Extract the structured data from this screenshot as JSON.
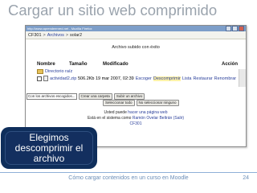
{
  "slide": {
    "title": "Cargar un sitio web comprimido",
    "footer": "Cómo cargar contenidos en un curso en Moodle",
    "page_number": "24"
  },
  "browser": {
    "window_title": "http://www.aprendeenred.net - Mozilla Firefox",
    "breadcrumb": {
      "root": "CF301",
      "sep1": ">",
      "files": "Archivos",
      "sep2": ">",
      "folder": "solar2"
    },
    "message": "Archivo subido con éxito",
    "table": {
      "headers": {
        "name": "Nombre",
        "size": "Tamaño",
        "modified": "Modificado",
        "action": "Acción"
      },
      "parent_dir": "Directorio raíz",
      "file": {
        "name": "actividad2.zip",
        "size": "506.2Kb",
        "modified": "19 mar 2007, 02:39",
        "action_choose": "Escoger",
        "action_unzip": "Descomprimir",
        "action_list": "Lista",
        "action_restore": "Restaurar",
        "action_rename": "Renombrar"
      }
    },
    "bottom": {
      "select_value": "Con los archivos escogidos...",
      "create_folder": "Crear una carpeta",
      "upload": "Subir un archivo",
      "select_all": "Seleccionar todo",
      "select_none": "No seleccionar ninguno"
    },
    "footer_links": {
      "line1_prefix": "Usted puede",
      "line1_link": "hacer una página web",
      "line1_suffix": "en el sistema como",
      "line2_prefix": "Está en el sistema como",
      "line2_user": "Ramón Ovelar Beltrán",
      "line2_exit": "(Salir)",
      "line3": "CF301"
    }
  },
  "callout": {
    "text": "Elegimos\ndescomprimir el\narchivo"
  }
}
